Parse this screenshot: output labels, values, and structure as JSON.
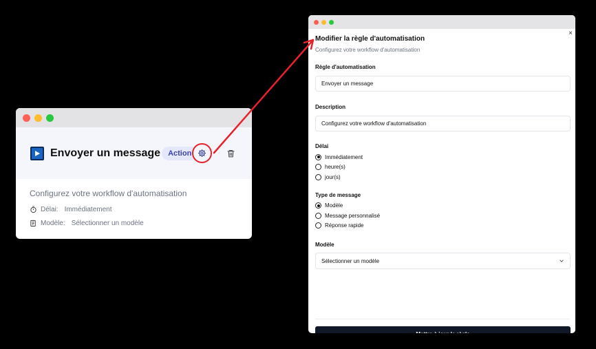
{
  "card": {
    "title": "Envoyer un message",
    "badge": "Action",
    "description": "Configurez votre workflow d'automatisation",
    "delay_label": "Délai:",
    "delay_value": "Immédiatement",
    "model_label": "Modèle:",
    "model_value": "Sélectionner un modèle"
  },
  "modal": {
    "title": "Modifier la règle d'automatisation",
    "subtitle": "Configurez votre workflow d'automatisation",
    "close": "×",
    "rule_label": "Règle d'automatisation",
    "rule_value": "Envoyer un message",
    "desc_label": "Description",
    "desc_value": "Configurez votre workflow d'automatisation",
    "delay_label": "Délai",
    "delay_options": [
      "Immédiatement",
      "heure(s)",
      "jour(s)"
    ],
    "type_label": "Type de message",
    "type_options": [
      "Modèle",
      "Message personnalisé",
      "Réponse rapide"
    ],
    "model_label": "Modèle",
    "model_select": "Sélectionner un modèle",
    "submit": "Mettre à jour la règle"
  },
  "colors": {
    "accent": "#e8222b",
    "badge_bg": "#e5e8fa",
    "badge_text": "#3c44a8",
    "button_dark": "#111827"
  }
}
